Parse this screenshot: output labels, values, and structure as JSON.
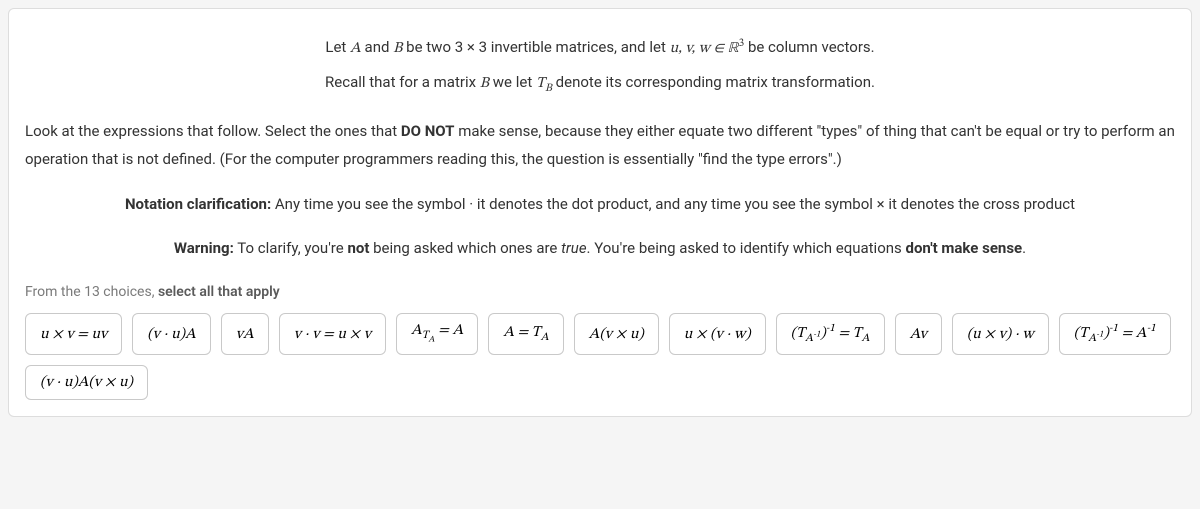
{
  "intro": {
    "line1_pre": "Let ",
    "line1_A": "A",
    "line1_mid1": " and ",
    "line1_B": "B",
    "line1_mid2": " be two 3 × 3 invertible matrices, and let ",
    "line1_vecs": "u, v, w ∈ ℝ",
    "line1_exp": "3",
    "line1_post": " be column vectors.",
    "line2_pre": "Recall that for a matrix ",
    "line2_B": "B",
    "line2_mid": " we let ",
    "line2_T": "T",
    "line2_sub": "B",
    "line2_post": " denote its corresponding matrix transformation."
  },
  "body1": "Look at the expressions that follow. Select the ones that DO NOT make sense, because they either equate two different \"types\" of thing that can't be equal or try to perform an operation that is not defined. (For the computer programmers reading this, the question is essentially \"find the type errors\".)",
  "body1_bold": "DO NOT",
  "note1_label": "Notation clarification:",
  "note1_text": " Any time you see the symbol · it denotes the dot product, and any time you see the symbol × it denotes the cross product",
  "note2_label": "Warning:",
  "note2_pre": " To clarify, you're ",
  "note2_not": "not",
  "note2_mid": " being asked which ones are ",
  "note2_true": "true",
  "note2_post": ". You're being asked to identify which equations ",
  "note2_dont": "don't make sense",
  "note2_end": ".",
  "select_hint_pre": "From the 13 choices, ",
  "select_hint_bold": "select all that apply",
  "choices": [
    "u × v = uv",
    "(v · u)A",
    "vA",
    "v · v = u × v",
    "A<sub>T<sub>A</sub></sub> = A",
    "A = T<sub>A</sub>",
    "A(v × u)",
    "u × (v · w)",
    "(T<sub>A<sup style='font-size:0.8em'>-1</sup></sub>)<sup>-1</sup> = T<sub>A</sub>",
    "Av",
    "(u × v) · w",
    "(T<sub>A<sup style='font-size:0.8em'>-1</sup></sub>)<sup>-1</sup> = A<sup>-1</sup>",
    "(v · u)A(v × u)"
  ]
}
